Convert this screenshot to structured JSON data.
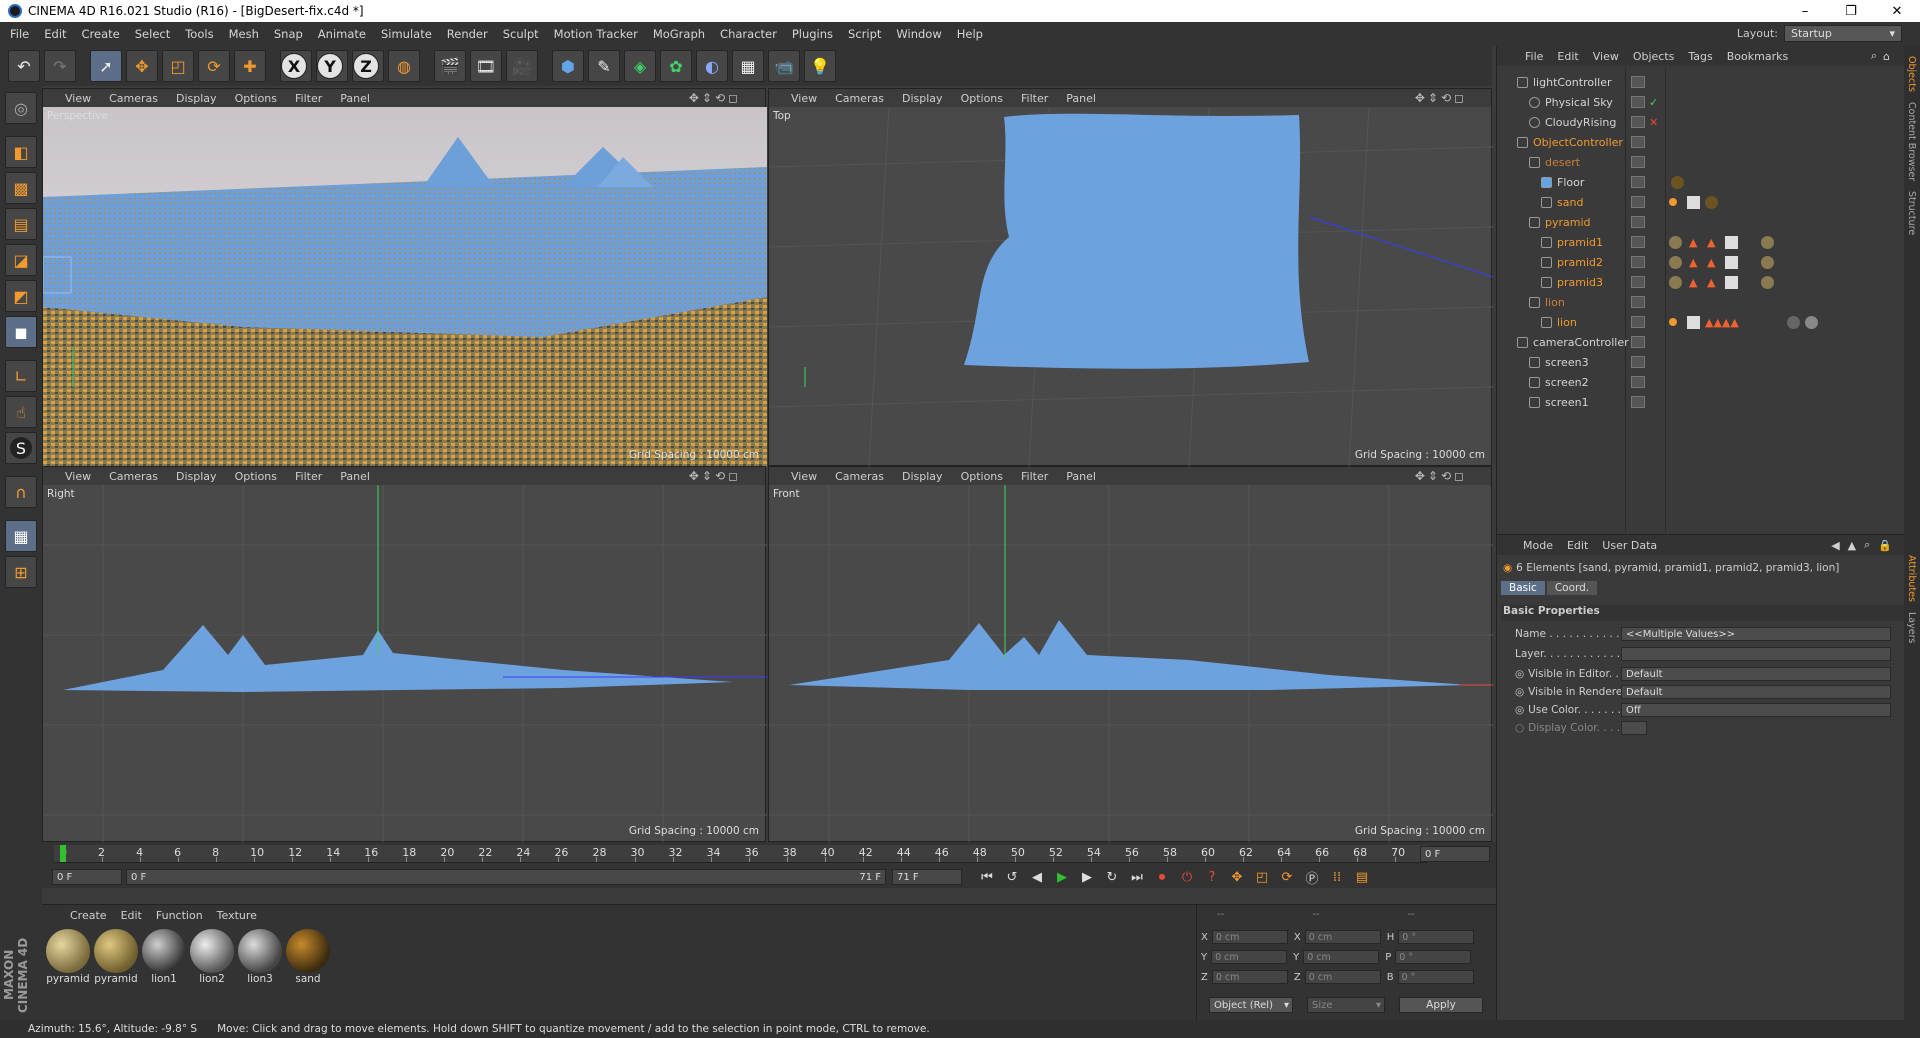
{
  "window": {
    "title": "CINEMA 4D R16.021 Studio (R16) - [BigDesert-fix.c4d *]",
    "controls": [
      "–",
      "❐",
      "✕"
    ]
  },
  "menubar": {
    "items": [
      "File",
      "Edit",
      "Create",
      "Select",
      "Tools",
      "Mesh",
      "Snap",
      "Animate",
      "Simulate",
      "Render",
      "Sculpt",
      "Motion Tracker",
      "MoGraph",
      "Character",
      "Plugins",
      "Script",
      "Window",
      "Help"
    ],
    "layout_label": "Layout:",
    "layout_value": "Startup"
  },
  "toolbar": {
    "axis_x": "X",
    "axis_y": "Y",
    "axis_z": "Z"
  },
  "viewport_menu": [
    "View",
    "Cameras",
    "Display",
    "Options",
    "Filter",
    "Panel"
  ],
  "viewports": {
    "perspective": {
      "name": "Perspective",
      "grid": "Grid Spacing : 10000 cm"
    },
    "top": {
      "name": "Top",
      "grid": "Grid Spacing : 10000 cm"
    },
    "right": {
      "name": "Right",
      "grid": "Grid Spacing : 10000 cm"
    },
    "front": {
      "name": "Front",
      "grid": "Grid Spacing : 10000 cm"
    }
  },
  "object_manager": {
    "menu": [
      "File",
      "Edit",
      "View",
      "Objects",
      "Tags",
      "Bookmarks"
    ],
    "objects": [
      {
        "label": "lightController",
        "style": "normal"
      },
      {
        "label": "Physical Sky",
        "style": "normal"
      },
      {
        "label": "CloudyRising",
        "style": "normal"
      },
      {
        "label": "ObjectController",
        "style": "orange"
      },
      {
        "label": "desert",
        "style": "dim"
      },
      {
        "label": "Floor",
        "style": "normal"
      },
      {
        "label": "sand",
        "style": "orange"
      },
      {
        "label": "pyramid",
        "style": "orange"
      },
      {
        "label": "pramid1",
        "style": "orange"
      },
      {
        "label": "pramid2",
        "style": "orange"
      },
      {
        "label": "pramid3",
        "style": "orange"
      },
      {
        "label": "lion",
        "style": "dim"
      },
      {
        "label": "lion",
        "style": "orange"
      },
      {
        "label": "cameraController",
        "style": "normal"
      },
      {
        "label": "screen3",
        "style": "normal"
      },
      {
        "label": "screen2",
        "style": "normal"
      },
      {
        "label": "screen1",
        "style": "normal"
      }
    ]
  },
  "attribute_manager": {
    "menu": [
      "Mode",
      "Edit",
      "User Data"
    ],
    "selection": "6 Elements [sand, pyramid, pramid1, pramid2, pramid3, lion]",
    "tabs": [
      "Basic",
      "Coord."
    ],
    "section": "Basic Properties",
    "fields": [
      {
        "label": "Name . . . . . . . . . . . .",
        "value": "<<Multiple Values>>"
      },
      {
        "label": "Layer. . . . . . . . . . . .",
        "value": ""
      },
      {
        "label": "Visible in Editor. . .",
        "value": "Default"
      },
      {
        "label": "Visible in Renderer",
        "value": "Default"
      },
      {
        "label": "Use Color. . . . . . . .",
        "value": "Off"
      },
      {
        "label": "Display Color. . . .",
        "value": ""
      }
    ]
  },
  "timeline": {
    "ticks": [
      "0",
      "2",
      "4",
      "6",
      "8",
      "10",
      "12",
      "14",
      "16",
      "18",
      "20",
      "22",
      "24",
      "26",
      "28",
      "30",
      "32",
      "34",
      "36",
      "38",
      "40",
      "42",
      "44",
      "46",
      "48",
      "50",
      "52",
      "54",
      "56",
      "58",
      "60",
      "62",
      "64",
      "66",
      "68",
      "70"
    ],
    "current_frame": "0 F",
    "start": "0 F",
    "range_start": "0 F",
    "range_end": "71 F",
    "end": "71 F"
  },
  "material_manager": {
    "menu": [
      "Create",
      "Edit",
      "Function",
      "Texture"
    ],
    "materials": [
      "pyramid",
      "pyramid",
      "lion1",
      "lion2",
      "lion3",
      "sand"
    ]
  },
  "coord_manager": {
    "header": [
      "--",
      "--",
      "--"
    ],
    "rows": [
      {
        "a": "X",
        "av": "0 cm",
        "b": "X",
        "bv": "0 cm",
        "c": "H",
        "cv": "0 °"
      },
      {
        "a": "Y",
        "av": "0 cm",
        "b": "Y",
        "bv": "0 cm",
        "c": "P",
        "cv": "0 °"
      },
      {
        "a": "Z",
        "av": "0 cm",
        "b": "Z",
        "bv": "0 cm",
        "c": "B",
        "cv": "0 °"
      }
    ],
    "mode": "Object (Rel)",
    "size": "Size",
    "apply": "Apply"
  },
  "status": {
    "left": "Azimuth: 15.6°, Altitude: -9.8°  S",
    "message": "Move: Click and drag to move elements. Hold down SHIFT to quantize movement / add to the selection in point mode, CTRL to remove."
  },
  "branding": "MAXON CINEMA 4D",
  "side_tabs": [
    "Objects",
    "Content Browser",
    "Structure",
    "Attributes",
    "Layers"
  ]
}
